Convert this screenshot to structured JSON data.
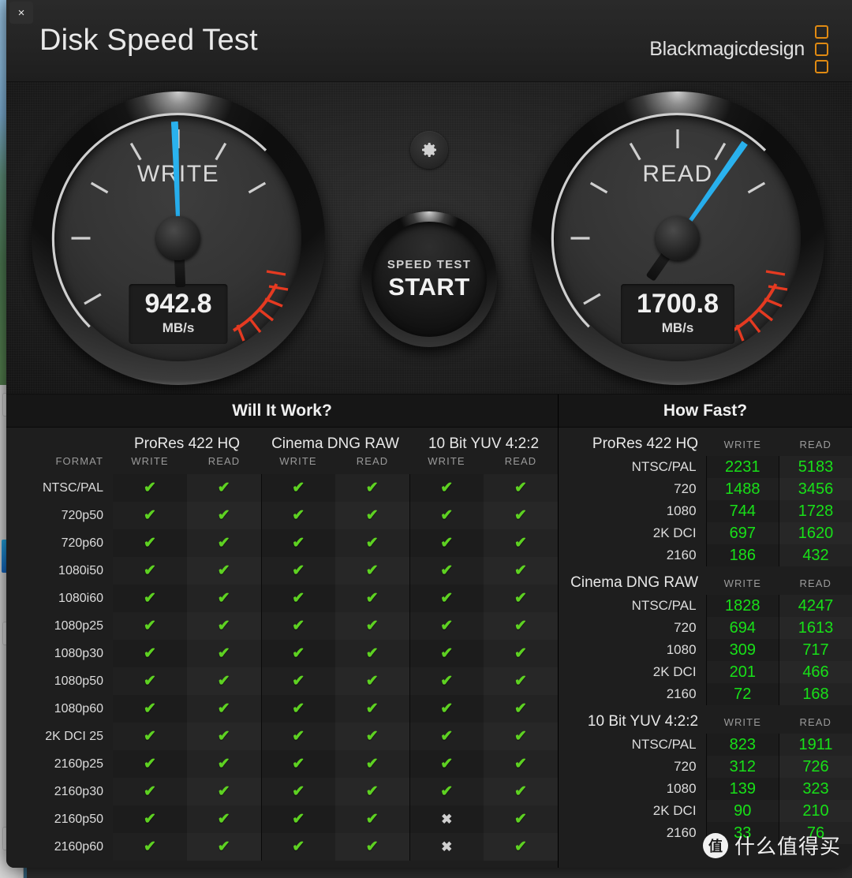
{
  "window": {
    "close_label": "×"
  },
  "header": {
    "title": "Disk Speed Test",
    "brand": "Blackmagicdesign",
    "brand_color": "#e08a12"
  },
  "gauges": {
    "write": {
      "label": "WRITE",
      "value": "942.8",
      "unit": "MB/s",
      "needle_deg": 268
    },
    "read": {
      "label": "READ",
      "value": "1700.8",
      "unit": "MB/s",
      "needle_deg": 305
    },
    "needle_color": "#29b0ec",
    "redzone_color": "#e53a21"
  },
  "center": {
    "gear_icon": "gear-icon",
    "start_small": "SPEED TEST",
    "start_big": "START"
  },
  "will_it_work": {
    "title": "Will It Work?",
    "format_header": "FORMAT",
    "codecs": [
      "ProRes 422 HQ",
      "Cinema DNG RAW",
      "10 Bit YUV 4:2:2"
    ],
    "sub_headers": [
      "WRITE",
      "READ"
    ],
    "ok_glyph": "✔",
    "no_glyph": "✖",
    "rows": [
      {
        "format": "NTSC/PAL",
        "cells": [
          true,
          true,
          true,
          true,
          true,
          true
        ]
      },
      {
        "format": "720p50",
        "cells": [
          true,
          true,
          true,
          true,
          true,
          true
        ]
      },
      {
        "format": "720p60",
        "cells": [
          true,
          true,
          true,
          true,
          true,
          true
        ]
      },
      {
        "format": "1080i50",
        "cells": [
          true,
          true,
          true,
          true,
          true,
          true
        ]
      },
      {
        "format": "1080i60",
        "cells": [
          true,
          true,
          true,
          true,
          true,
          true
        ]
      },
      {
        "format": "1080p25",
        "cells": [
          true,
          true,
          true,
          true,
          true,
          true
        ]
      },
      {
        "format": "1080p30",
        "cells": [
          true,
          true,
          true,
          true,
          true,
          true
        ]
      },
      {
        "format": "1080p50",
        "cells": [
          true,
          true,
          true,
          true,
          true,
          true
        ]
      },
      {
        "format": "1080p60",
        "cells": [
          true,
          true,
          true,
          true,
          true,
          true
        ]
      },
      {
        "format": "2K DCI 25",
        "cells": [
          true,
          true,
          true,
          true,
          true,
          true
        ]
      },
      {
        "format": "2160p25",
        "cells": [
          true,
          true,
          true,
          true,
          true,
          true
        ]
      },
      {
        "format": "2160p30",
        "cells": [
          true,
          true,
          true,
          true,
          true,
          true
        ]
      },
      {
        "format": "2160p50",
        "cells": [
          true,
          true,
          true,
          true,
          false,
          true
        ]
      },
      {
        "format": "2160p60",
        "cells": [
          true,
          true,
          true,
          true,
          false,
          true
        ]
      }
    ]
  },
  "how_fast": {
    "title": "How Fast?",
    "col_headers": [
      "WRITE",
      "READ"
    ],
    "groups": [
      {
        "name": "ProRes 422 HQ",
        "rows": [
          {
            "label": "NTSC/PAL",
            "write": "2231",
            "read": "5183"
          },
          {
            "label": "720",
            "write": "1488",
            "read": "3456"
          },
          {
            "label": "1080",
            "write": "744",
            "read": "1728"
          },
          {
            "label": "2K DCI",
            "write": "697",
            "read": "1620"
          },
          {
            "label": "2160",
            "write": "186",
            "read": "432"
          }
        ]
      },
      {
        "name": "Cinema DNG RAW",
        "rows": [
          {
            "label": "NTSC/PAL",
            "write": "1828",
            "read": "4247"
          },
          {
            "label": "720",
            "write": "694",
            "read": "1613"
          },
          {
            "label": "1080",
            "write": "309",
            "read": "717"
          },
          {
            "label": "2K DCI",
            "write": "201",
            "read": "466"
          },
          {
            "label": "2160",
            "write": "72",
            "read": "168"
          }
        ]
      },
      {
        "name": "10 Bit YUV 4:2:2",
        "rows": [
          {
            "label": "NTSC/PAL",
            "write": "823",
            "read": "1911"
          },
          {
            "label": "720",
            "write": "312",
            "read": "726"
          },
          {
            "label": "1080",
            "write": "139",
            "read": "323"
          },
          {
            "label": "2K DCI",
            "write": "90",
            "read": "210"
          },
          {
            "label": "2160",
            "write": "33",
            "read": "76"
          }
        ]
      }
    ],
    "value_color": "#18e018"
  },
  "watermark": {
    "logo": "值",
    "text": "什么值得买"
  }
}
